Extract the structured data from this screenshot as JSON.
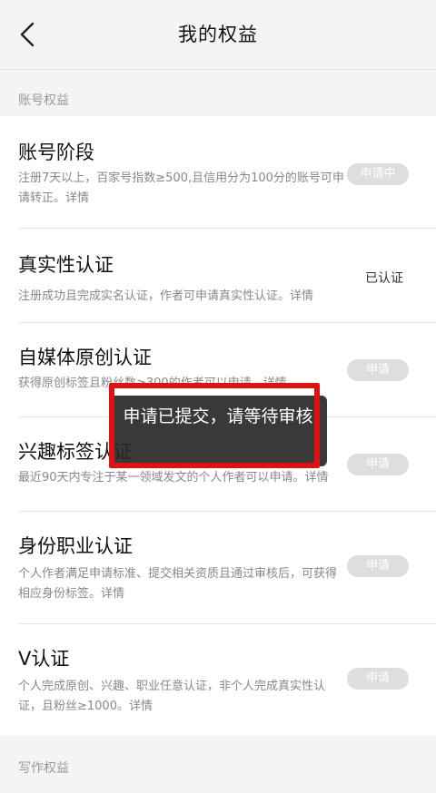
{
  "header": {
    "title": "我的权益"
  },
  "sections": {
    "account": "账号权益",
    "writing": "写作权益"
  },
  "items": [
    {
      "title": "账号阶段",
      "desc": "注册7天以上，百家号指数≥500,且信用分为100分的账号可申请转正。详情",
      "action": "申请中"
    },
    {
      "title": "真实性认证",
      "desc": "注册成功且完成实名认证，作者可申请真实性认证。详情",
      "status": "已认证"
    },
    {
      "title": "自媒体原创认证",
      "desc": "获得原创标签且粉丝数≥300的作者可以申请。详情",
      "action": "申请"
    },
    {
      "title": "兴趣标签认证",
      "desc": "最近90天内专注于某一领域发文的个人作者可以申请。详情",
      "action": "申请"
    },
    {
      "title": "身份职业认证",
      "desc": "个人作者满足申请标准、提交相关资质且通过审核后，可获得相应身份标签。详情",
      "action": "申请"
    },
    {
      "title": "V认证",
      "desc": "个人完成原创、兴趣、职业任意认证，非个人完成真实性认证，且粉丝≥1000。详情",
      "action": "申请"
    }
  ],
  "toast": {
    "text": "申请已提交，请等待审核"
  },
  "colors": {
    "highlight": "#e01111",
    "pill_bg": "#dedede",
    "toast_bg": "#282828"
  }
}
